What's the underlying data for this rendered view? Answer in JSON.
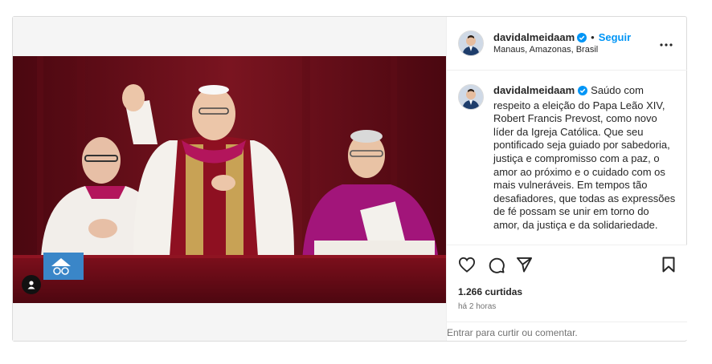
{
  "post": {
    "username": "davidalmeidaam",
    "follow_label": "Seguir",
    "separator": "•",
    "location": "Manaus, Amazonas, Brasil",
    "caption_text": "Saúdo com respeito a eleição do Papa Leão XIV, Robert Francis Prevost, como novo líder da Igreja Católica. Que seu pontificado seja guiado por sabedoria, justiça e compromisso com a paz, o amor ao próximo e o cuidado com os mais vulneráveis. Em tempos tão desafiadores, que todas as expressões de fé possam se unir em torno do amor, da justiça e da solidariedade.",
    "likes": "1.266 curtidas",
    "time": "há 2 horas",
    "login_link": "Entrar",
    "login_rest": " para curtir ou comentar."
  },
  "media": {
    "watermark": "VATICAN MEDIA"
  },
  "icons": {
    "verified": "verified-badge-icon",
    "more": "more-options-icon",
    "like": "heart-icon",
    "comment": "comment-icon",
    "share": "share-icon",
    "save": "bookmark-icon",
    "user_tag": "user-tag-icon"
  },
  "colors": {
    "accent": "#0095f6",
    "text": "#262626",
    "muted": "#737373",
    "border": "#dbdbdb"
  }
}
